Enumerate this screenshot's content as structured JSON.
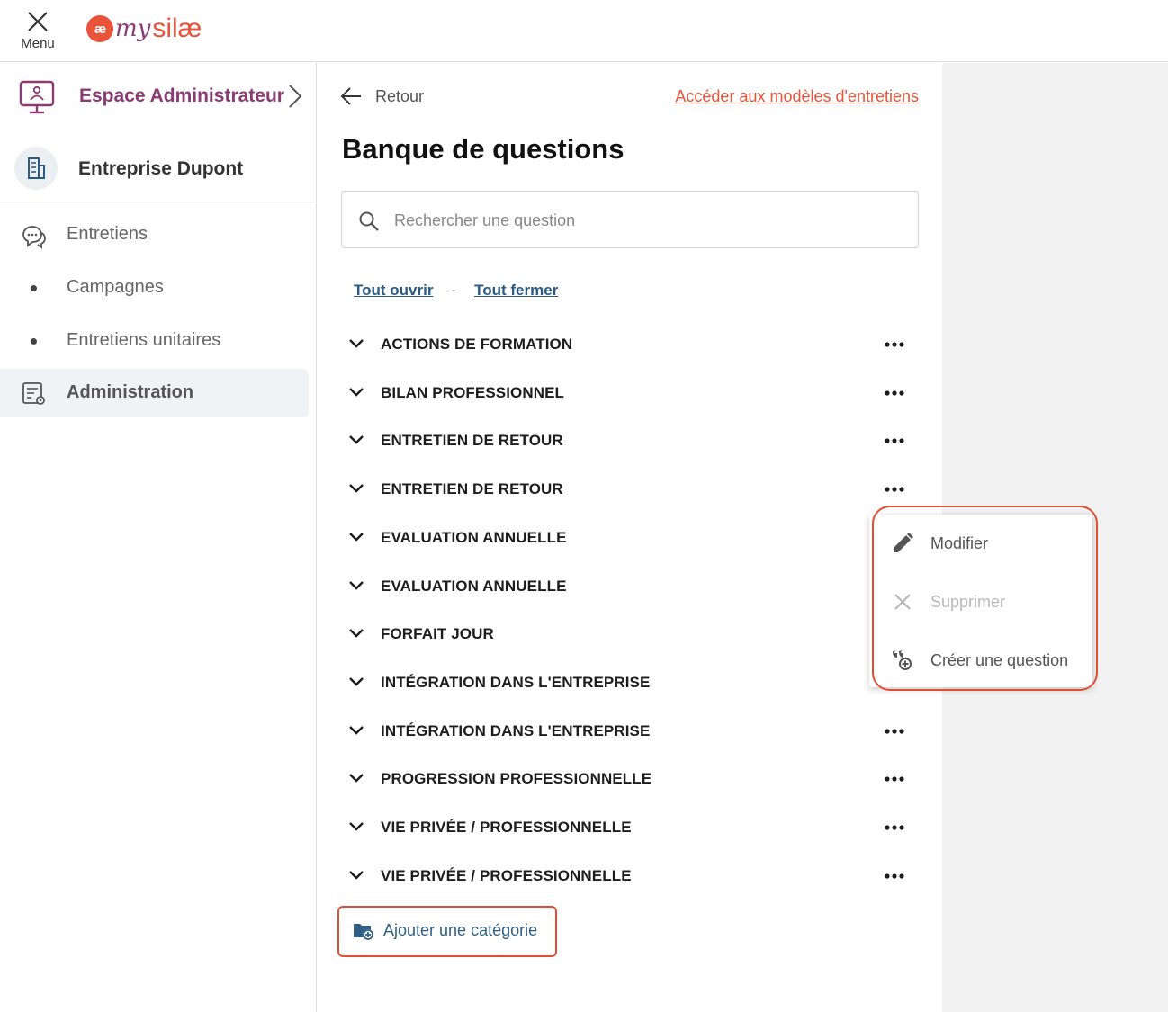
{
  "topbar": {
    "menu_label": "Menu",
    "logo_badge": "æ",
    "logo_my": "my",
    "logo_silae": "silæ"
  },
  "sidebar": {
    "space_label": "Espace Administrateur",
    "company_name": "Entreprise Dupont",
    "items": [
      {
        "label": "Entretiens",
        "icon": "chat-bubbles-icon"
      },
      {
        "label": "Campagnes"
      },
      {
        "label": "Entretiens unitaires"
      },
      {
        "label": "Administration",
        "icon": "admin-settings-icon",
        "active": true
      }
    ]
  },
  "main": {
    "back_label": "Retour",
    "models_link": "Accéder aux modèles d'entretiens",
    "title": "Banque de questions",
    "search_placeholder": "Rechercher une question",
    "open_all": "Tout ouvrir",
    "separator": "-",
    "close_all": "Tout fermer",
    "categories": [
      "ACTIONS DE FORMATION",
      "BILAN PROFESSIONNEL",
      "ENTRETIEN DE RETOUR",
      "ENTRETIEN DE RETOUR",
      "EVALUATION ANNUELLE",
      "EVALUATION ANNUELLE",
      "FORFAIT JOUR",
      "INTÉGRATION DANS L'ENTREPRISE",
      "INTÉGRATION DANS L'ENTREPRISE",
      "PROGRESSION PROFESSIONNELLE",
      "VIE PRIVÉE / PROFESSIONNELLE",
      "VIE PRIVÉE / PROFESSIONNELLE"
    ],
    "add_category": "Ajouter une catégorie"
  },
  "popup": {
    "items": [
      {
        "label": "Modifier",
        "icon": "pencil-icon",
        "disabled": false
      },
      {
        "label": "Supprimer",
        "icon": "close-icon",
        "disabled": true
      },
      {
        "label": "Créer une question",
        "icon": "quote-add-icon",
        "disabled": false
      }
    ]
  },
  "colors": {
    "brand_orange": "#e8533a",
    "brand_purple": "#8a3b72",
    "link_blue": "#2b5b84",
    "highlight_red": "#e04e33"
  }
}
